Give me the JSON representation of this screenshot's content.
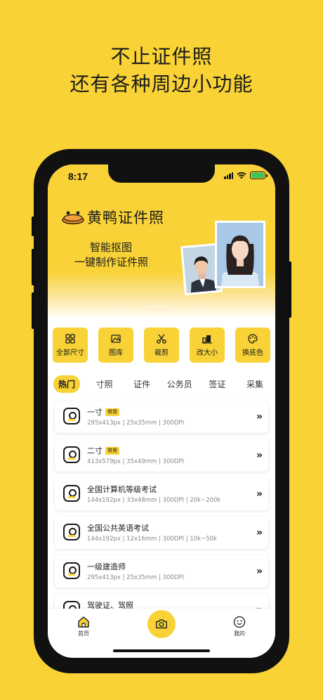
{
  "promo": {
    "line1": "不止证件照",
    "line2": "还有各种周边小功能"
  },
  "status": {
    "time": "8:17"
  },
  "banner": {
    "brand": "黄鸭证件照",
    "slogan_line1": "智能抠图",
    "slogan_line2": "一键制作证件照"
  },
  "tools": [
    {
      "label": "全部尺寸",
      "icon": "grid-icon"
    },
    {
      "label": "图库",
      "icon": "image-icon"
    },
    {
      "label": "裁剪",
      "icon": "scissors-icon"
    },
    {
      "label": "改大小",
      "icon": "resize-icon"
    },
    {
      "label": "换底色",
      "icon": "palette-icon"
    }
  ],
  "tabs": [
    "热门",
    "寸照",
    "证件",
    "公务员",
    "签证",
    "采集"
  ],
  "active_tab": "热门",
  "items": [
    {
      "title": "一寸",
      "tag": "常用",
      "spec": "295x413px  |  25x35mm  |  300DPI"
    },
    {
      "title": "二寸",
      "tag": "常用",
      "spec": "413x579px  |  35x49mm  |  300DPI"
    },
    {
      "title": "全国计算机等级考试",
      "tag": "",
      "spec": "144x192px  |  33x48mm  |  300DPI  |  20k~200k"
    },
    {
      "title": "全国公共英语考试",
      "tag": "",
      "spec": "144x192px  |  12x16mm  |  300DPI  |  10k~50k"
    },
    {
      "title": "一级建造师",
      "tag": "",
      "spec": "295x413px  |  25x35mm  |  300DPI"
    },
    {
      "title": "驾驶证、驾照",
      "tag": "",
      "spec": ""
    }
  ],
  "tabbar": {
    "home": "首页",
    "mine": "我的"
  },
  "colors": {
    "accent": "#f8d237",
    "background": "#f9d335"
  }
}
